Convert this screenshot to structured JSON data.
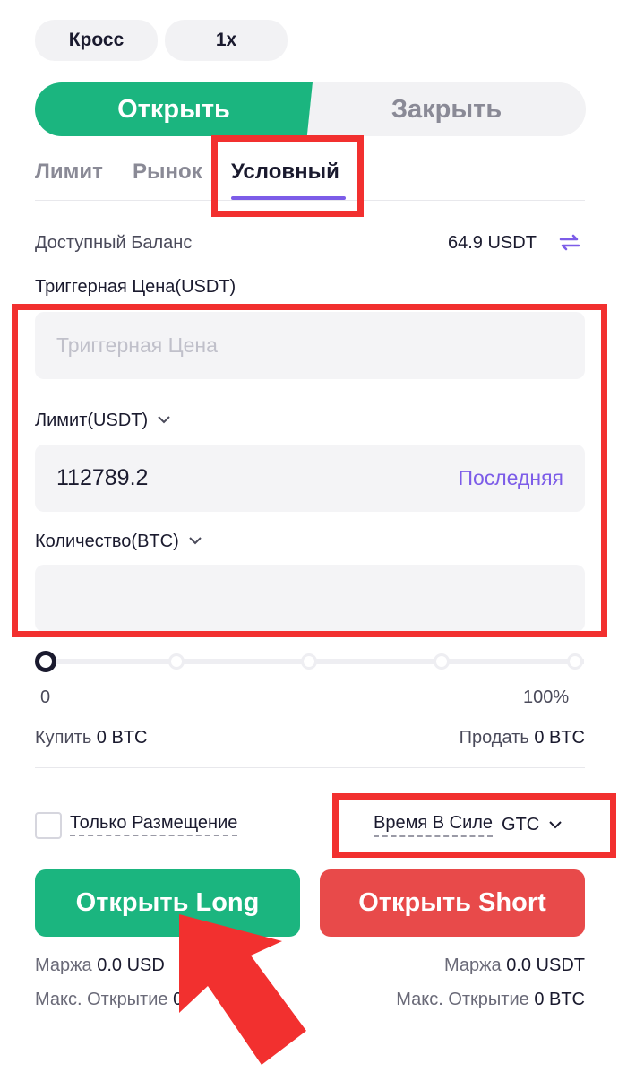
{
  "mode": {
    "margin_mode": "Кросс",
    "leverage": "1x"
  },
  "action_tabs": {
    "open": "Открыть",
    "close": "Закрыть"
  },
  "order_tabs": {
    "limit": "Лимит",
    "market": "Рынок",
    "conditional": "Условный"
  },
  "balance": {
    "label": "Доступный Баланс",
    "value": "64.9 USDT",
    "swap_icon": "swap-arrows-icon"
  },
  "trigger": {
    "label": "Триггерная Цена(USDT)",
    "placeholder": "Триггерная Цена"
  },
  "limit": {
    "label": "Лимит(USDT)",
    "value": "112789.2",
    "last_button": "Последняя"
  },
  "quantity": {
    "label": "Количество(BTC)",
    "value": ""
  },
  "slider": {
    "min_label": "0",
    "max_label": "100%",
    "level": 0
  },
  "summary": {
    "buy_label": "Купить",
    "buy_value": "0 BTC",
    "sell_label": "Продать",
    "sell_value": "0 BTC"
  },
  "options": {
    "post_only": "Только Размещение",
    "tif_label": "Время В Силе",
    "tif_value": "GTC"
  },
  "buttons": {
    "long": "Открыть Long",
    "short": "Открыть Short"
  },
  "margin_info": {
    "long_label": "Маржа",
    "long_value": "0.0 USD",
    "short_label": "Маржа",
    "short_value": "0.0 USDT",
    "long_max_label": "Макс. Открытие",
    "long_max_value": "0",
    "short_max_label": "Макс. Открытие",
    "short_max_value": "0 BTC"
  },
  "colors": {
    "green": "#1bb57f",
    "red": "#e84a4a",
    "accent": "#7c5ce8",
    "highlight": "#f2302f"
  }
}
